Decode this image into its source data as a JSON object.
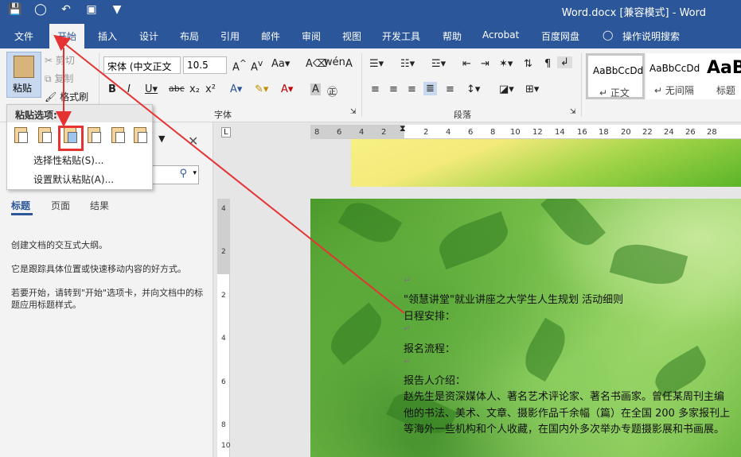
{
  "window": {
    "title": "Word.docx [兼容模式]  -  Word"
  },
  "tabs": [
    {
      "label": "文件"
    },
    {
      "label": "开始"
    },
    {
      "label": "插入"
    },
    {
      "label": "设计"
    },
    {
      "label": "布局"
    },
    {
      "label": "引用"
    },
    {
      "label": "邮件"
    },
    {
      "label": "审阅"
    },
    {
      "label": "视图"
    },
    {
      "label": "开发工具"
    },
    {
      "label": "帮助"
    },
    {
      "label": "Acrobat"
    },
    {
      "label": "百度网盘"
    },
    {
      "label": "操作说明搜索"
    }
  ],
  "ribbon": {
    "paste_label": "粘贴",
    "cut_label": "剪切",
    "copy_label": "复制",
    "format_painter_label": "格式刷",
    "font_name": "宋体 (中文正文",
    "font_size": "10.5",
    "font_group_label": "字体",
    "paragraph_group_label": "段落",
    "styles": [
      {
        "sample": "AaBbCcDd",
        "name": "↵ 正文"
      },
      {
        "sample": "AaBbCcDd",
        "name": "↵ 无间隔"
      },
      {
        "sample": "AaB",
        "name": "标题"
      }
    ]
  },
  "paste_menu": {
    "header": "粘贴选项:",
    "items": [
      {
        "label": "选择性粘贴(S)..."
      },
      {
        "label": "设置默认粘贴(A)..."
      }
    ]
  },
  "nav_pane": {
    "tabs": [
      {
        "label": "标题"
      },
      {
        "label": "页面"
      },
      {
        "label": "结果"
      }
    ],
    "text1": "创建文档的交互式大纲。",
    "text2": "它是跟踪具体位置或快速移动内容的好方式。",
    "text3": "若要开始，请转到\"开始\"选项卡，并向文档中的标题应用标题样式。"
  },
  "ruler": {
    "h_ticks": [
      "8",
      "6",
      "4",
      "2",
      "2",
      "4",
      "6",
      "8",
      "10",
      "12",
      "14",
      "16",
      "18",
      "20",
      "22",
      "24",
      "26",
      "28"
    ],
    "v_ticks": [
      "4",
      "2",
      "2",
      "4",
      "6",
      "8",
      "10"
    ]
  },
  "document": {
    "lines": [
      "\"领慧讲堂\"就业讲座之大学生人生规划  活动细则",
      "日程安排：",
      "报名流程：",
      "报告人介绍：",
      "赵先生是资深媒体人、著名艺术评论家、著名书画家。曾任某周刊主编",
      "他的书法、美术、文章、摄影作品千余幅（篇）在全国 200 多家报刊上",
      "等海外一些机构和个人收藏，在国内外多次举办专题摄影展和书画展。"
    ]
  },
  "colors": {
    "brand": "#2b579a",
    "annotation": "#e53333"
  }
}
